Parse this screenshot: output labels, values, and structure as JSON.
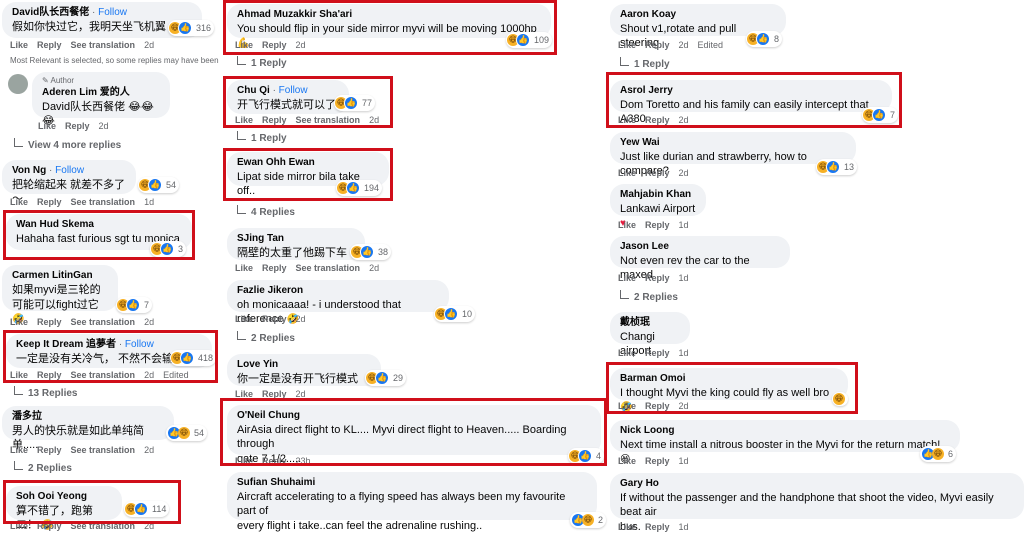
{
  "labels": {
    "like": "Like",
    "reply": "Reply",
    "see_translation": "See translation",
    "edited": "Edited",
    "follow": "Follow",
    "author_badge": "Author"
  },
  "col1": {
    "c1": {
      "author": "David队长西餐佬",
      "text": "假如你快过它，我明天坐飞机翼",
      "reacts": "316",
      "time": "2d"
    },
    "note": "Most Relevant is selected, so some replies may have been",
    "c2": {
      "author": "Aderen Lim 爱的人",
      "text": "David队长西餐佬 😂😂😂",
      "time": "2d"
    },
    "more": "View 4 more replies",
    "c3": {
      "author": "Von Ng",
      "text": "把轮缩起来 就差不多了～",
      "reacts": "54",
      "time": "1d"
    },
    "c4": {
      "author": "Wan Hud Skema",
      "text": "Hahaha fast furious sgt tu monica",
      "reacts": "3"
    },
    "c5": {
      "author": "Carmen LitinGan",
      "text1": "如果myvi是三轮的",
      "text2": "可能可以fight过它",
      "reacts": "7",
      "time": "2d"
    },
    "c6": {
      "author": "Keep It Dream 追夢者",
      "text": "一定是没有关冷气， 不然不会输",
      "reacts": "418",
      "time": "2d"
    },
    "r6": "13 Replies",
    "c7": {
      "author": "潘多拉",
      "text": "男人的快乐就是如此单纯简单.....",
      "reacts": "54",
      "time": "2d"
    },
    "r7": "2 Replies",
    "c8": {
      "author": "Soh Ooi Yeong",
      "text": "算不错了，跑第二！",
      "reacts": "114",
      "time": "2d"
    }
  },
  "col2": {
    "c1": {
      "author": "Ahmad Muzakkir Sha'ari",
      "text": "You should flip in your side mirror myvi will be moving 1000hp",
      "reacts": "109",
      "time": "2d"
    },
    "r1": "1 Reply",
    "c2": {
      "author": "Chu Qi",
      "text": "开飞行模式就可以了",
      "reacts": "77",
      "time": "2d"
    },
    "r2": "1 Reply",
    "c3": {
      "author": "Ewan Ohh Ewan",
      "text": "Lipat side mirror bila take off..",
      "reacts": "194",
      "time": "2d"
    },
    "r3": "4 Replies",
    "c4": {
      "author": "SJing Tan",
      "text": "隔壁的太重了他踢下车",
      "reacts": "38",
      "time": "2d"
    },
    "c5": {
      "author": "Fazlie Jikeron",
      "text": "oh monicaaaa! - i understood that reference",
      "reacts": "10",
      "time": "2d"
    },
    "r5": "2 Replies",
    "c6": {
      "author": "Love Yin",
      "text": "你一定是没有开飞行模式",
      "reacts": "29",
      "time": "2d"
    },
    "c7": {
      "author": "O'Neil Chung",
      "text1": "AirAsia direct flight to KL.... Myvi direct flight to Heaven..... Boarding through",
      "text2": "gate 7 1/2.....",
      "reacts": "4",
      "time": "23h"
    },
    "c8": {
      "author": "Sufian Shuhaimi",
      "text1": "Aircraft accelerating to a flying speed has always been my favourite part of",
      "text2": "every flight i take..can feel the adrenaline rushing..",
      "reacts": "2"
    }
  },
  "col3": {
    "c1": {
      "author": "Aaron Koay",
      "text": "Shout v1,rotate and pull steering",
      "reacts": "8",
      "time": "2d"
    },
    "r1": "1 Reply",
    "c2": {
      "author": "Asrol Jerry",
      "text": "Dom Toretto and his family can easily intercept that A380",
      "reacts": "7",
      "time": "2d"
    },
    "c3": {
      "author": "Yew Wai",
      "text": "Just like durian and strawberry, how to compare?",
      "reacts": "13",
      "time": "2d"
    },
    "c4": {
      "author": "Mahjabin Khan",
      "text": "Lankawi Airport",
      "time": "1d"
    },
    "c5": {
      "author": "Jason Lee",
      "text": "Not even rev the car to the maxed",
      "time": "1d"
    },
    "r5": "2 Replies",
    "c6": {
      "author": "戴桢珉",
      "text": "Changi airport",
      "time": "1d"
    },
    "c7": {
      "author": "Barman Omoi",
      "text": "I thought Myvi the king could fly as well bro",
      "time": "2d"
    },
    "c8": {
      "author": "Nick Loong",
      "text": "Next time install a nitrous booster in the Myvi for the return match!",
      "reacts": "6",
      "time": "1d"
    },
    "c9": {
      "author": "Gary Ho",
      "text1": "If without the passenger and the handphone that shoot the video, Myvi easily beat air",
      "text2": "bus.",
      "time": "1d"
    }
  },
  "colors": {
    "highlight": "#d00f1a",
    "bubble": "#f0f2f5",
    "link": "#1877f2",
    "muted": "#65676b"
  }
}
